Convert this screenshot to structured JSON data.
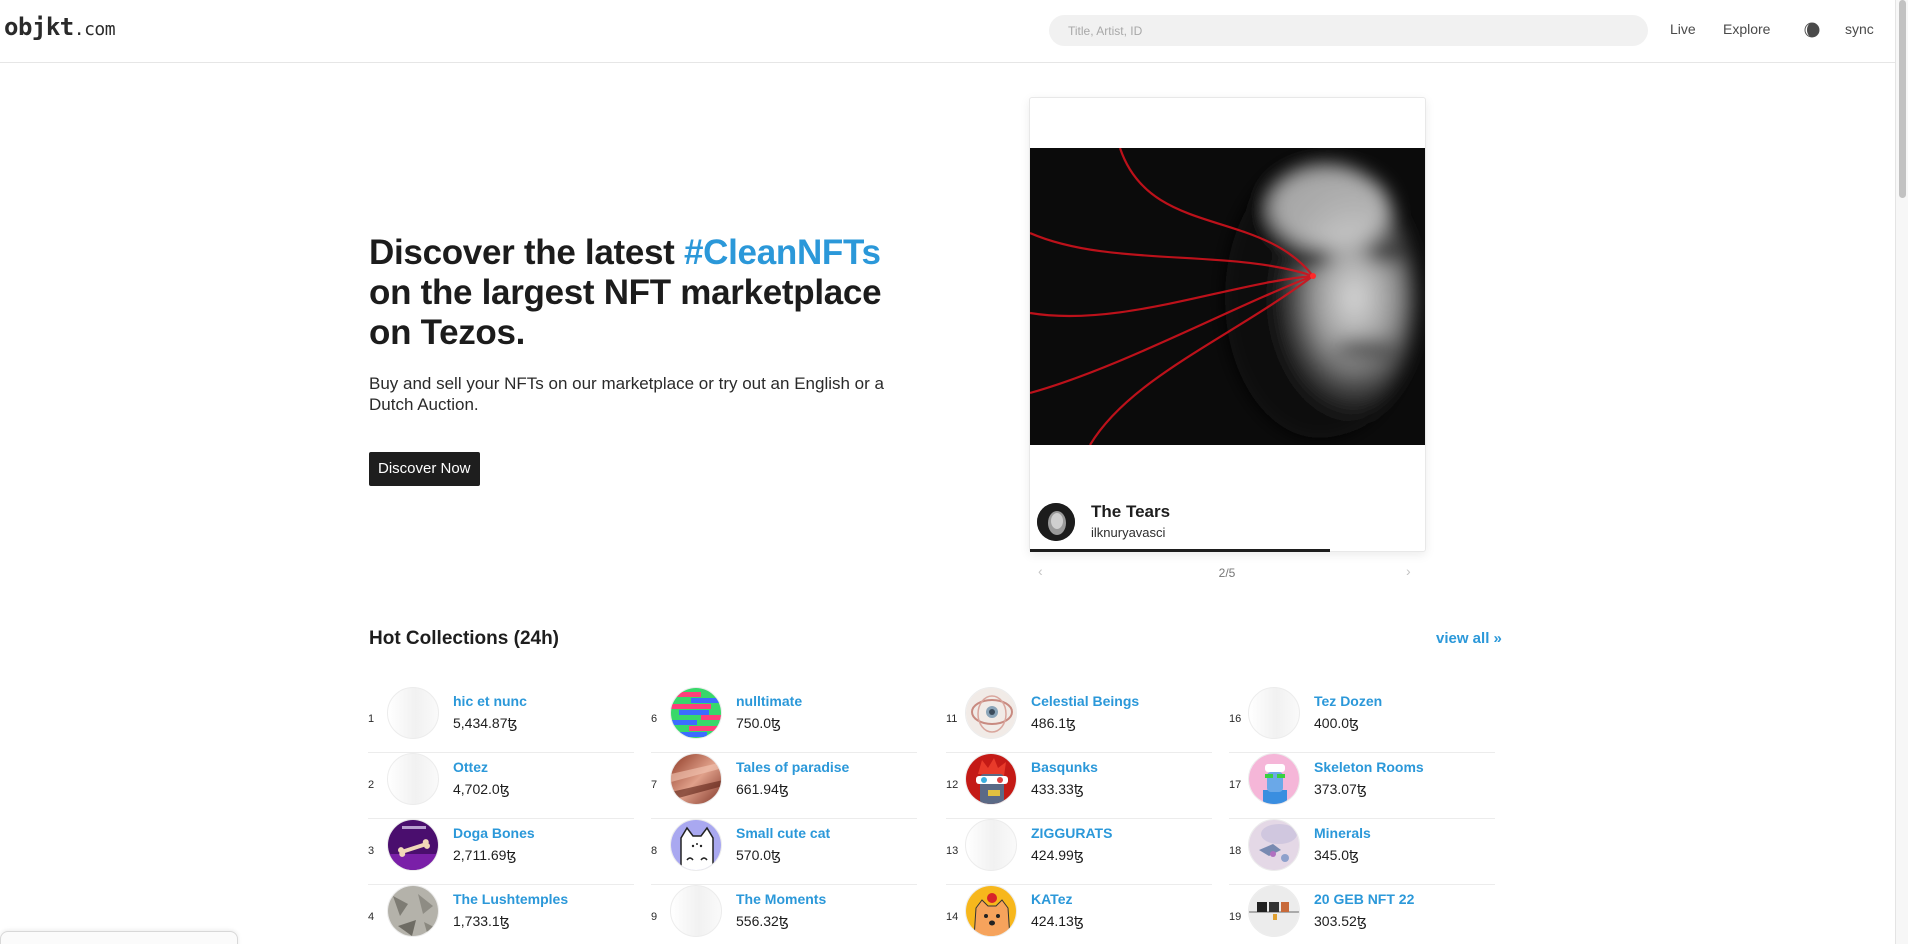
{
  "header": {
    "logo_main": "objkt",
    "logo_tld": ".com",
    "search_placeholder": "Title, Artist, ID",
    "search_value": "",
    "nav": {
      "live": "Live",
      "explore": "Explore",
      "theme_icon": "half-moon-theme-icon",
      "sync": "sync"
    }
  },
  "hero": {
    "title_before": "Discover the latest ",
    "title_accent": "#CleanNFTs",
    "title_after": " on the largest NFT marketplace on Tezos.",
    "subtitle": "Buy and sell your NFTs on our marketplace or try out an English or a Dutch Auction.",
    "cta_label": "Discover Now"
  },
  "featured": {
    "title": "The Tears",
    "artist": "ilknuryavasci",
    "pager": "2/5",
    "prev_icon": "‹",
    "next_icon": "›",
    "progress_percent": 76
  },
  "hot_collections": {
    "title": "Hot Collections (24h)",
    "view_all": "view all »",
    "currency_symbol": "ꜩ",
    "columns": [
      [
        {
          "rank": "1",
          "name": "hic et nunc",
          "volume": "5,434.87",
          "thumb": "blank"
        },
        {
          "rank": "2",
          "name": "Ottez",
          "volume": "4,702.0",
          "thumb": "blank"
        },
        {
          "rank": "3",
          "name": "Doga Bones",
          "volume": "2,711.69",
          "thumb": "bone"
        },
        {
          "rank": "4",
          "name": "The Lushtemples",
          "volume": "1,733.1",
          "thumb": "stone"
        }
      ],
      [
        {
          "rank": "6",
          "name": "nulltimate",
          "volume": "750.0",
          "thumb": "glitch"
        },
        {
          "rank": "7",
          "name": "Tales of paradise",
          "volume": "661.94",
          "thumb": "sunset"
        },
        {
          "rank": "8",
          "name": "Small cute cat",
          "volume": "570.0",
          "thumb": "cat"
        },
        {
          "rank": "9",
          "name": "The Moments",
          "volume": "556.32",
          "thumb": "blank"
        }
      ],
      [
        {
          "rank": "11",
          "name": "Celestial Beings",
          "volume": "486.1",
          "thumb": "eye"
        },
        {
          "rank": "12",
          "name": "Basqunks",
          "volume": "433.33",
          "thumb": "punk"
        },
        {
          "rank": "13",
          "name": "ZIGGURATS",
          "volume": "424.99",
          "thumb": "blank"
        },
        {
          "rank": "14",
          "name": "KATez",
          "volume": "424.13",
          "thumb": "katez"
        }
      ],
      [
        {
          "rank": "16",
          "name": "Tez Dozen",
          "volume": "400.0",
          "thumb": "blank"
        },
        {
          "rank": "17",
          "name": "Skeleton Rooms",
          "volume": "373.07",
          "thumb": "skeleton"
        },
        {
          "rank": "18",
          "name": "Minerals",
          "volume": "345.0",
          "thumb": "minerals"
        },
        {
          "rank": "19",
          "name": "20 GEB NFT 22",
          "volume": "303.52",
          "thumb": "geb"
        }
      ]
    ]
  },
  "colors": {
    "accent": "#2b98d9",
    "text": "#1e1e1e",
    "button_bg": "#1e1e1e"
  }
}
